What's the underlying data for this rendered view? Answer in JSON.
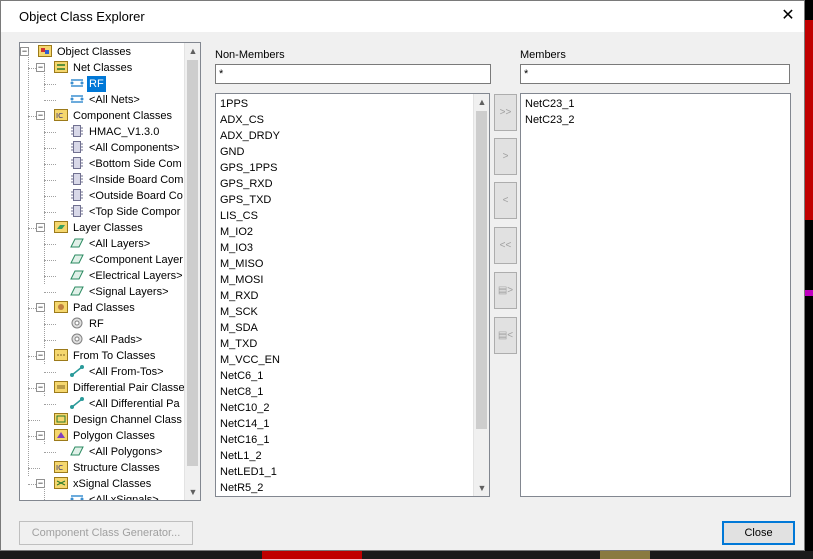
{
  "window": {
    "title": "Object Class Explorer",
    "close_glyph": "✕"
  },
  "tree": {
    "nodes": [
      {
        "label": "Object Classes",
        "level": 0,
        "expander": "−",
        "icon": "object-classes-icon"
      },
      {
        "label": "Net Classes",
        "level": 1,
        "expander": "−",
        "icon": "net-classes-icon"
      },
      {
        "label": "RF",
        "level": 2,
        "icon": "net-class-icon",
        "selected": true
      },
      {
        "label": "<All Nets>",
        "level": 2,
        "icon": "net-class-icon"
      },
      {
        "label": "Component Classes",
        "level": 1,
        "expander": "−",
        "icon": "component-classes-icon"
      },
      {
        "label": "HMAC_V1.3.0",
        "level": 2,
        "icon": "component-class-icon"
      },
      {
        "label": "<All Components>",
        "level": 2,
        "icon": "component-class-icon"
      },
      {
        "label": "<Bottom Side Com",
        "level": 2,
        "icon": "component-class-icon"
      },
      {
        "label": "<Inside Board Com",
        "level": 2,
        "icon": "component-class-icon"
      },
      {
        "label": "<Outside Board Co",
        "level": 2,
        "icon": "component-class-icon"
      },
      {
        "label": "<Top Side Compor",
        "level": 2,
        "icon": "component-class-icon"
      },
      {
        "label": "Layer Classes",
        "level": 1,
        "expander": "−",
        "icon": "layer-classes-icon"
      },
      {
        "label": "<All Layers>",
        "level": 2,
        "icon": "layer-class-icon"
      },
      {
        "label": "<Component Layer",
        "level": 2,
        "icon": "layer-class-icon"
      },
      {
        "label": "<Electrical Layers>",
        "level": 2,
        "icon": "layer-class-icon"
      },
      {
        "label": "<Signal Layers>",
        "level": 2,
        "icon": "layer-class-icon"
      },
      {
        "label": "Pad Classes",
        "level": 1,
        "expander": "−",
        "icon": "pad-classes-icon"
      },
      {
        "label": "RF",
        "level": 2,
        "icon": "pad-class-icon"
      },
      {
        "label": "<All Pads>",
        "level": 2,
        "icon": "pad-class-icon"
      },
      {
        "label": "From To Classes",
        "level": 1,
        "expander": "−",
        "icon": "from-to-classes-icon"
      },
      {
        "label": "<All From-Tos>",
        "level": 2,
        "icon": "from-to-class-icon"
      },
      {
        "label": "Differential Pair Classe",
        "level": 1,
        "expander": "−",
        "icon": "diff-pair-classes-icon"
      },
      {
        "label": "<All Differential Pa",
        "level": 2,
        "icon": "from-to-class-icon"
      },
      {
        "label": "Design Channel Class",
        "level": 1,
        "icon": "design-channel-classes-icon"
      },
      {
        "label": "Polygon Classes",
        "level": 1,
        "expander": "−",
        "icon": "polygon-classes-icon"
      },
      {
        "label": "<All Polygons>",
        "level": 2,
        "icon": "layer-class-icon"
      },
      {
        "label": "Structure Classes",
        "level": 1,
        "icon": "structure-classes-icon"
      },
      {
        "label": "xSignal Classes",
        "level": 1,
        "expander": "−",
        "icon": "xsignal-classes-icon"
      },
      {
        "label": "<All xSignals>",
        "level": 2,
        "icon": "net-class-icon"
      }
    ],
    "scroll_up": "▲",
    "scroll_down": "▼"
  },
  "non_members": {
    "label": "Non-Members",
    "filter_value": "*",
    "items": [
      "1PPS",
      "ADX_CS",
      "ADX_DRDY",
      "GND",
      "GPS_1PPS",
      "GPS_RXD",
      "GPS_TXD",
      "LIS_CS",
      "M_IO2",
      "M_IO3",
      "M_MISO",
      "M_MOSI",
      "M_RXD",
      "M_SCK",
      "M_SDA",
      "M_TXD",
      "M_VCC_EN",
      "NetC6_1",
      "NetC8_1",
      "NetC10_2",
      "NetC14_1",
      "NetC16_1",
      "NetL1_2",
      "NetLED1_1",
      "NetR5_2"
    ],
    "scroll_up": "▲",
    "scroll_down": "▼"
  },
  "members": {
    "label": "Members",
    "filter_value": "*",
    "items": [
      "NetC23_1",
      "NetC23_2"
    ]
  },
  "move_buttons": {
    "add_all": ">>",
    "add": ">",
    "remove": "<",
    "remove_all": "<<",
    "add_special": "▤>",
    "remove_special": "▤<"
  },
  "buttons": {
    "generator": "Component Class Generator...",
    "close": "Close"
  },
  "colors": {
    "selection": "#0078d7",
    "accent_border": "#0078d7"
  }
}
